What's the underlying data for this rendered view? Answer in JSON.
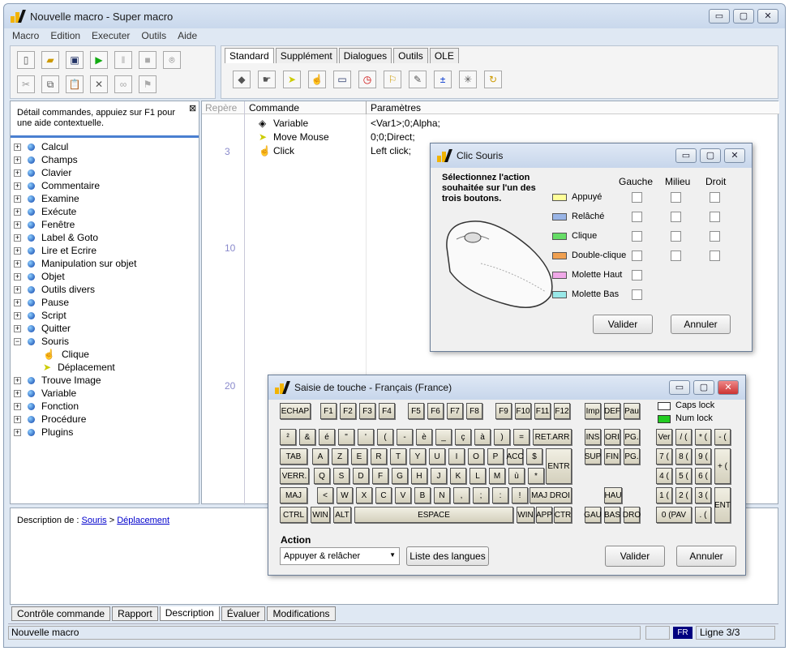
{
  "window": {
    "title": "Nouvelle macro - Super macro",
    "min": "▭",
    "max": "▢",
    "close": "✕"
  },
  "menu": [
    "Macro",
    "Edition",
    "Executer",
    "Outils",
    "Aide"
  ],
  "tabs": [
    "Standard",
    "Supplément",
    "Dialogues",
    "Outils",
    "OLE"
  ],
  "left_panel": {
    "hint": "Détail commandes, appuiez sur F1 pour une aide contextuelle.",
    "close": "⊠"
  },
  "tree": [
    "Calcul",
    "Champs",
    "Clavier",
    "Commentaire",
    "Examine",
    "Exécute",
    "Fenêtre",
    "Label & Goto",
    "Lire et Ecrire",
    "Manipulation sur objet",
    "Objet",
    "Outils divers",
    "Pause",
    "Script",
    "Quitter",
    "Souris",
    "Trouve Image",
    "Variable",
    "Fonction",
    "Procédure",
    "Plugins"
  ],
  "tree_children": [
    "Clique",
    "Déplacement"
  ],
  "grid": {
    "headers": [
      "Repère",
      "Commande",
      "Paramètres"
    ],
    "line_numbers": [
      "3",
      "10",
      "20"
    ],
    "rows": [
      {
        "cmd": "Variable",
        "param": "<Var1>;0;Alpha;"
      },
      {
        "cmd": "Move Mouse",
        "param": "0;0;Direct;"
      },
      {
        "cmd": "Click",
        "param": "Left click;"
      }
    ]
  },
  "description": {
    "label": "Description de : ",
    "link1": "Souris",
    "sep": " > ",
    "link2": "Déplacement"
  },
  "bottom_tabs": [
    "Contrôle commande",
    "Rapport",
    "Description",
    "Évaluer",
    "Modifications"
  ],
  "status": {
    "left": "Nouvelle macro",
    "lang": "FR",
    "line": "Ligne 3/3"
  },
  "clic_dialog": {
    "title": "Clic Souris",
    "instruction": "Sélectionnez l'action souhaitée sur l'un des trois boutons.",
    "cols": [
      "Gauche",
      "Milieu",
      "Droit"
    ],
    "rows": [
      {
        "label": "Appuyé",
        "color": "#ffff99"
      },
      {
        "label": "Relâché",
        "color": "#99b4e6"
      },
      {
        "label": "Clique",
        "color": "#66dd66"
      },
      {
        "label": "Double-clique",
        "color": "#f0a050"
      },
      {
        "label": "Molette Haut",
        "color": "#f0a8e8"
      },
      {
        "label": "Molette Bas",
        "color": "#99e8e8"
      }
    ],
    "ok": "Valider",
    "cancel": "Annuler"
  },
  "key_dialog": {
    "title": "Saisie de touche - Français (France)",
    "caps": "Caps lock",
    "num": "Num lock",
    "action_label": "Action",
    "action_value": "Appuyer & relâcher",
    "lang_button": "Liste des langues",
    "ok": "Valider",
    "cancel": "Annuler",
    "keys": {
      "fn": [
        "ECHAP",
        "F1",
        "F2",
        "F3",
        "F4",
        "F5",
        "F6",
        "F7",
        "F8",
        "F9",
        "F10",
        "F11",
        "F12",
        "Imp",
        "DEF",
        "Pau"
      ],
      "r1": [
        "²",
        "&",
        "é",
        "\"",
        "'",
        "(",
        "-",
        "è",
        "_",
        "ç",
        "à",
        ")",
        "=",
        "RET.ARR"
      ],
      "r2": [
        "TAB",
        "A",
        "Z",
        "E",
        "R",
        "T",
        "Y",
        "U",
        "I",
        "O",
        "P",
        "ACC",
        "$",
        "ENTR"
      ],
      "r3": [
        "VERR.",
        "Q",
        "S",
        "D",
        "F",
        "G",
        "H",
        "J",
        "K",
        "L",
        "M",
        "ù",
        "*"
      ],
      "r4": [
        "MAJ",
        "<",
        "W",
        "X",
        "C",
        "V",
        "B",
        "N",
        ",",
        ";",
        ":",
        "!",
        "MAJ DROI"
      ],
      "r5": [
        "CTRL",
        "WIN",
        "ALT",
        "ESPACE",
        "WIN",
        "APP",
        "CTR"
      ],
      "nav": [
        "INS",
        "ORI",
        "PG.",
        "SUP",
        "FIN",
        "PG.",
        "HAU",
        "GAU",
        "BAS",
        "DRO"
      ],
      "num": [
        "Ver",
        "/ (",
        "* (",
        "- (",
        "7 (",
        "8 (",
        "9 (",
        "+ (",
        "4 (",
        "5 (",
        "6 (",
        "1 (",
        "2 (",
        "3 (",
        "ENT",
        "0 (PAV",
        ". ("
      ]
    }
  }
}
